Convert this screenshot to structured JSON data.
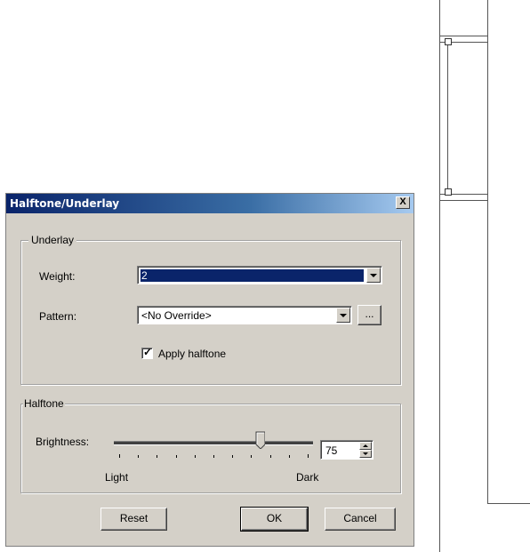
{
  "dialog": {
    "title": "Halftone/Underlay",
    "close_glyph": "X"
  },
  "underlay": {
    "group_label": "Underlay",
    "weight_label": "Weight:",
    "weight_value": "2",
    "pattern_label": "Pattern:",
    "pattern_value": "<No Override>",
    "browse_label": "...",
    "apply_halftone_label": "Apply halftone",
    "apply_halftone_checked": true
  },
  "halftone": {
    "group_label": "Halftone",
    "brightness_label": "Brightness:",
    "brightness_value": "75",
    "brightness_fraction": 0.75,
    "light_label": "Light",
    "dark_label": "Dark"
  },
  "buttons": {
    "reset": "Reset",
    "ok": "OK",
    "cancel": "Cancel"
  },
  "icons": {
    "combo_arrow": "chevron-down-icon",
    "spin_up": "spin-up-icon",
    "spin_down": "spin-down-icon",
    "check": "checkmark-icon"
  },
  "colors": {
    "dialog_bg": "#d4d0c8",
    "title_start": "#0a246a",
    "selection": "#0a246a"
  }
}
